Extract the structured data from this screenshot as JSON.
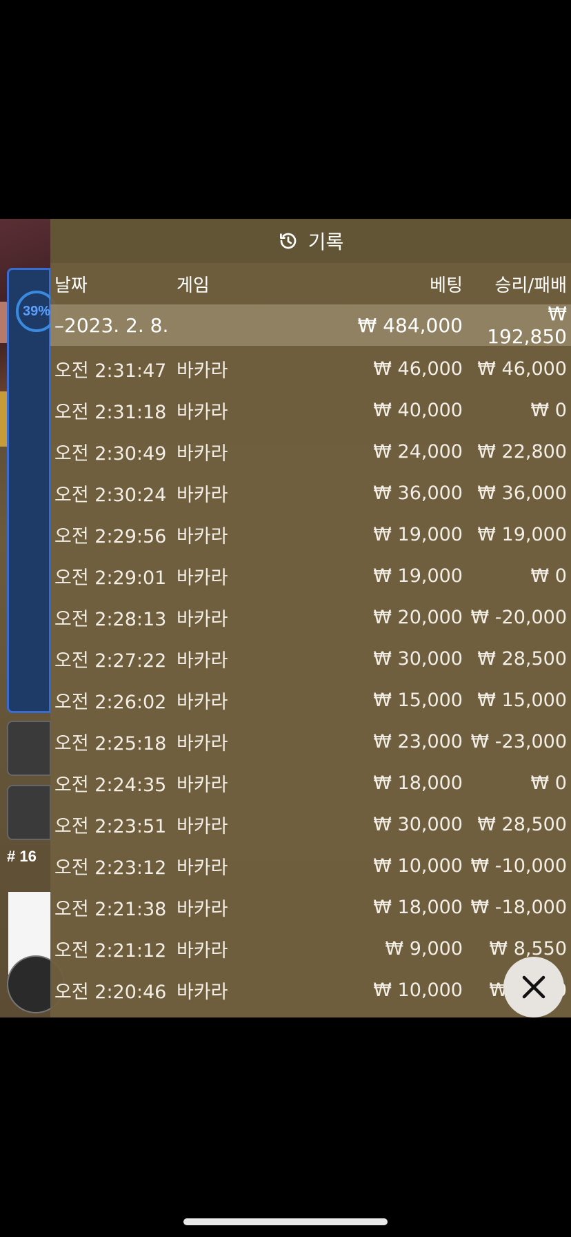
{
  "header": {
    "title": "기록",
    "icon": "history-icon"
  },
  "columns": {
    "date": "날짜",
    "game": "게임",
    "bet": "베팅",
    "win_loss": "승리/패배"
  },
  "summary": {
    "date": "–2023. 2. 8.",
    "bet": "₩ 484,000",
    "win_loss": "₩ 192,850"
  },
  "rows": [
    {
      "time": "오전 2:31:47",
      "game": "바카라",
      "bet": "₩ 46,000",
      "win_loss": "₩ 46,000"
    },
    {
      "time": "오전 2:31:18",
      "game": "바카라",
      "bet": "₩ 40,000",
      "win_loss": "₩ 0"
    },
    {
      "time": "오전 2:30:49",
      "game": "바카라",
      "bet": "₩ 24,000",
      "win_loss": "₩ 22,800"
    },
    {
      "time": "오전 2:30:24",
      "game": "바카라",
      "bet": "₩ 36,000",
      "win_loss": "₩ 36,000"
    },
    {
      "time": "오전 2:29:56",
      "game": "바카라",
      "bet": "₩ 19,000",
      "win_loss": "₩ 19,000"
    },
    {
      "time": "오전 2:29:01",
      "game": "바카라",
      "bet": "₩ 19,000",
      "win_loss": "₩ 0"
    },
    {
      "time": "오전 2:28:13",
      "game": "바카라",
      "bet": "₩ 20,000",
      "win_loss": "₩ -20,000"
    },
    {
      "time": "오전 2:27:22",
      "game": "바카라",
      "bet": "₩ 30,000",
      "win_loss": "₩ 28,500"
    },
    {
      "time": "오전 2:26:02",
      "game": "바카라",
      "bet": "₩ 15,000",
      "win_loss": "₩ 15,000"
    },
    {
      "time": "오전 2:25:18",
      "game": "바카라",
      "bet": "₩ 23,000",
      "win_loss": "₩ -23,000"
    },
    {
      "time": "오전 2:24:35",
      "game": "바카라",
      "bet": "₩ 18,000",
      "win_loss": "₩ 0"
    },
    {
      "time": "오전 2:23:51",
      "game": "바카라",
      "bet": "₩ 30,000",
      "win_loss": "₩ 28,500"
    },
    {
      "time": "오전 2:23:12",
      "game": "바카라",
      "bet": "₩ 10,000",
      "win_loss": "₩ -10,000"
    },
    {
      "time": "오전 2:21:38",
      "game": "바카라",
      "bet": "₩ 18,000",
      "win_loss": "₩ -18,000"
    },
    {
      "time": "오전 2:21:12",
      "game": "바카라",
      "bet": "₩ 9,000",
      "win_loss": "₩ 8,550"
    },
    {
      "time": "오전 2:20:46",
      "game": "바카라",
      "bet": "₩ 10,000",
      "win_loss": "₩ 9,500"
    }
  ],
  "background": {
    "percent": "39%",
    "round": "# 16"
  },
  "close": {
    "icon": "close-icon"
  }
}
